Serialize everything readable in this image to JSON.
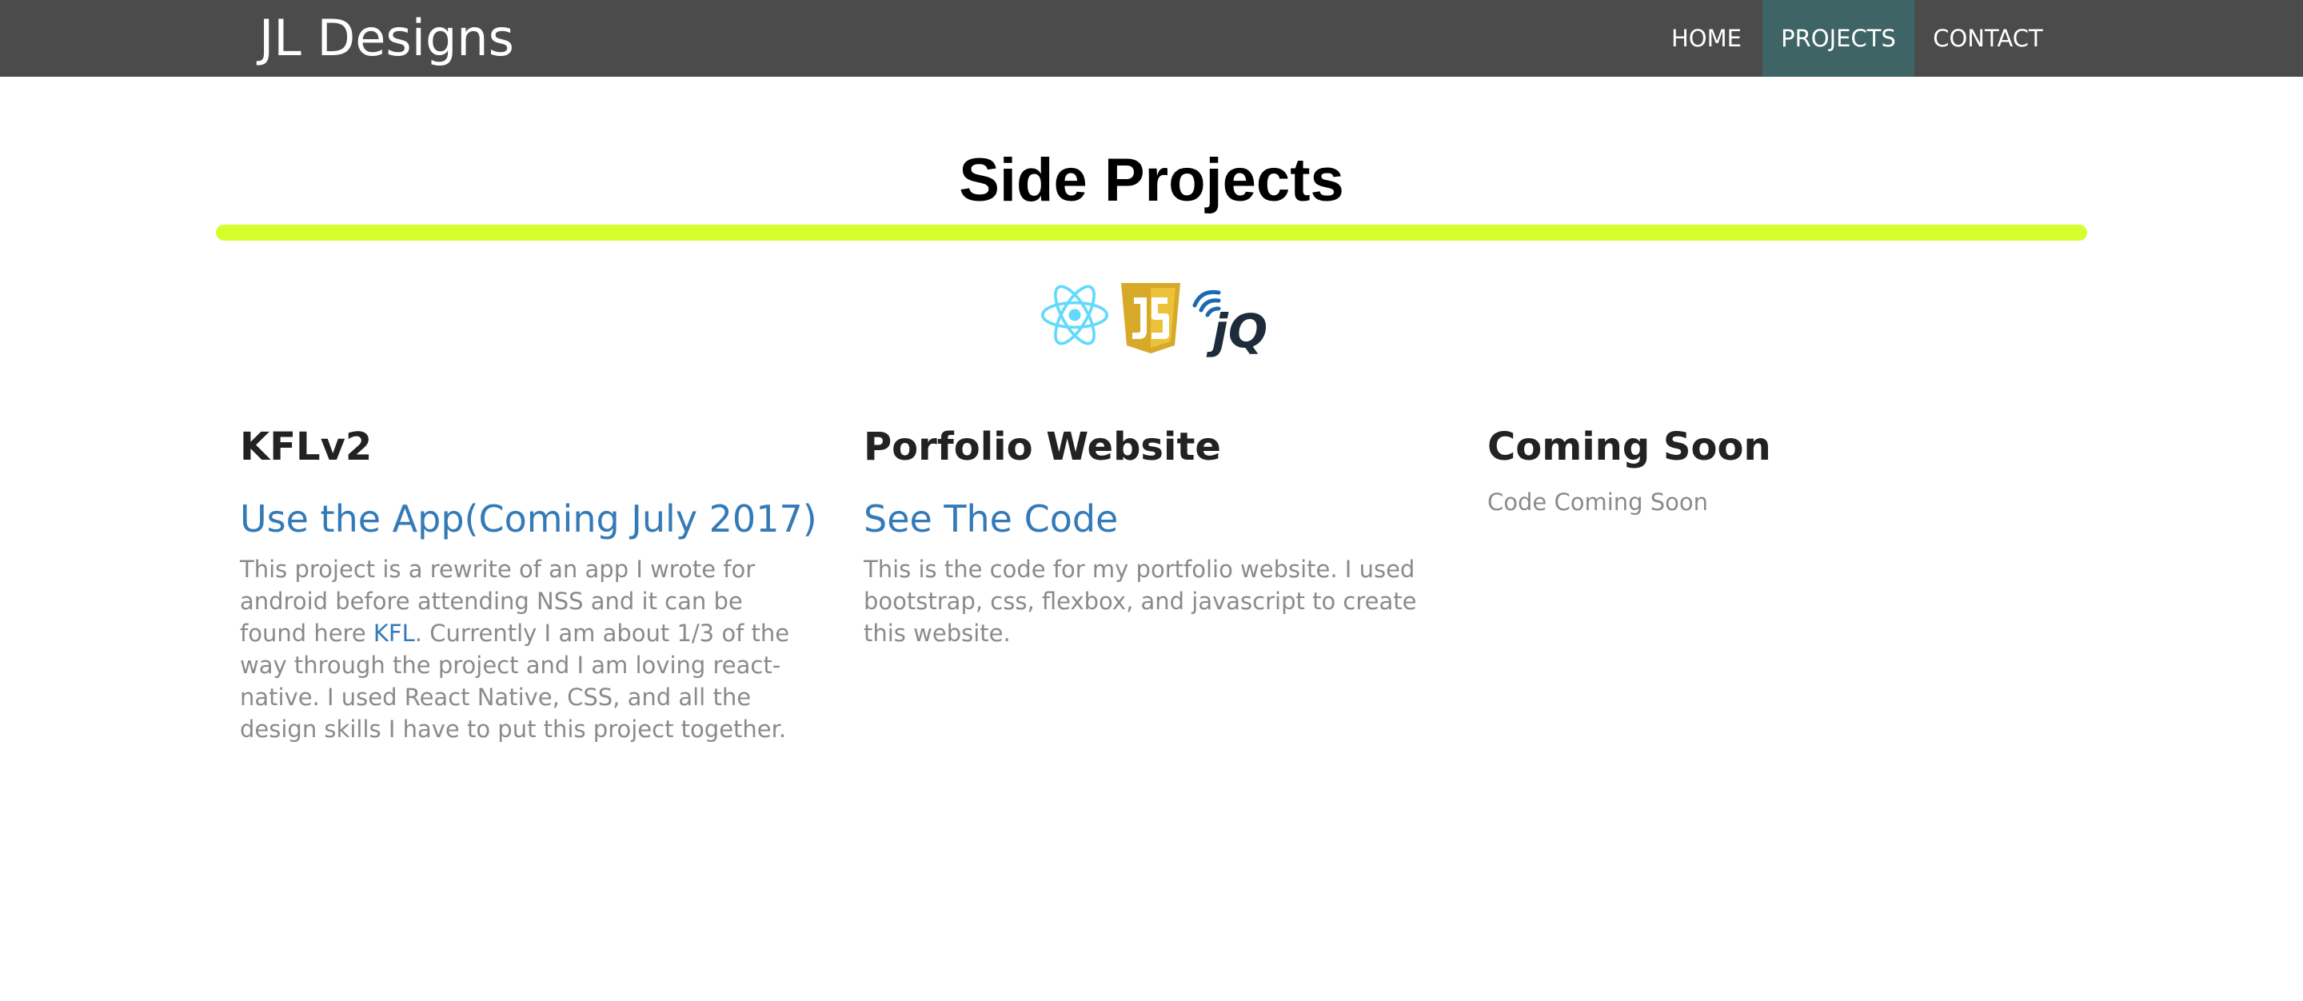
{
  "nav": {
    "brand": "JL Designs",
    "items": [
      {
        "label": "HOME",
        "active": false
      },
      {
        "label": "PROJECTS",
        "active": true
      },
      {
        "label": "CONTACT",
        "active": false
      }
    ],
    "bar_color": "#4b4b4b",
    "active_color": "#3f6465"
  },
  "main": {
    "title": "Side Projects",
    "underline_color": "#d4ff2a",
    "tech_icons": [
      "react-icon",
      "javascript-icon",
      "jquery-icon"
    ],
    "projects": [
      {
        "title": "KFLv2",
        "link": "Use the App(Coming July 2017)",
        "desc_before": "This project is a rewrite of an app I wrote for android before attending NSS and it can be found here ",
        "desc_link": "KFL",
        "desc_after": ". Currently I am about 1/3 of the way through the project and I am loving react-native. I used React Native, CSS, and all the design skills I have to put this project together."
      },
      {
        "title": "Porfolio Website",
        "link": "See The Code",
        "desc": "This is the code for my portfolio website. I used bootstrap, css, flexbox, and javascript to create this website."
      },
      {
        "title": "Coming Soon",
        "note": "Code Coming Soon"
      }
    ],
    "link_color": "#337ab7"
  }
}
